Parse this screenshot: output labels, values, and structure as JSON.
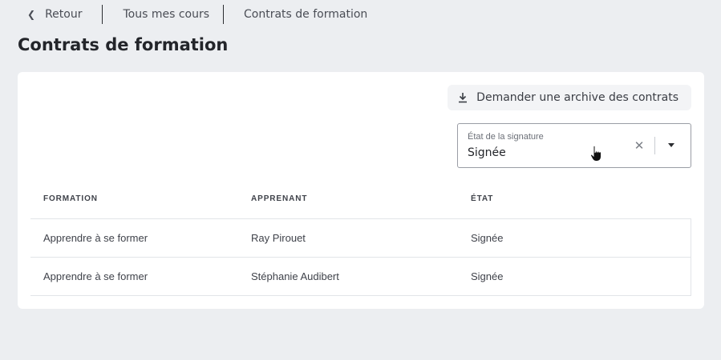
{
  "breadcrumb": {
    "back_label": "Retour",
    "items": [
      "Tous mes cours",
      "Contrats de formation"
    ]
  },
  "page": {
    "title": "Contrats de formation"
  },
  "toolbar": {
    "archive_label": "Demander une archive des contrats",
    "archive_icon": "download-icon"
  },
  "filter": {
    "label": "État de la signature",
    "value": "Signée"
  },
  "table": {
    "headers": [
      "FORMATION",
      "APPRENANT",
      "ÉTAT"
    ],
    "rows": [
      [
        "Apprendre à se former",
        "Ray Pirouet",
        "Signée"
      ],
      [
        "Apprendre à se former",
        "Stéphanie Audibert",
        "Signée"
      ]
    ]
  }
}
